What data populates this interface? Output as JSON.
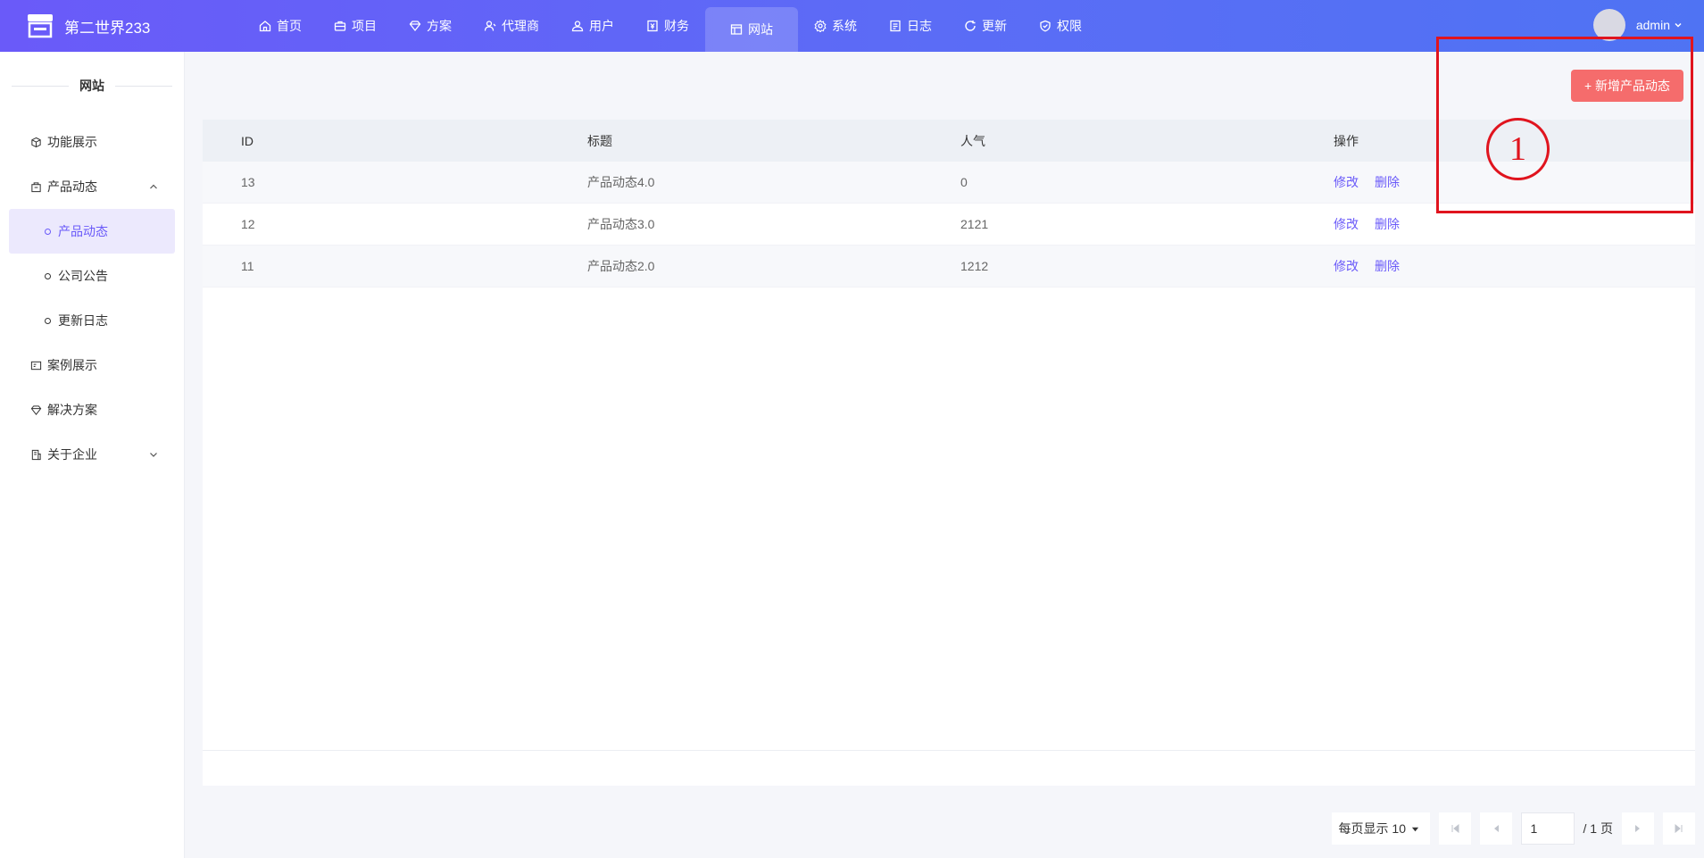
{
  "app": {
    "name": "第二世界233"
  },
  "nav": {
    "items": [
      {
        "label": "首页",
        "icon": "home-icon"
      },
      {
        "label": "项目",
        "icon": "briefcase-icon"
      },
      {
        "label": "方案",
        "icon": "diamond-icon"
      },
      {
        "label": "代理商",
        "icon": "agent-icon"
      },
      {
        "label": "用户",
        "icon": "users-icon"
      },
      {
        "label": "财务",
        "icon": "finance-icon"
      },
      {
        "label": "网站",
        "icon": "website-icon",
        "active": true
      },
      {
        "label": "系统",
        "icon": "gear-icon"
      },
      {
        "label": "日志",
        "icon": "log-icon"
      },
      {
        "label": "更新",
        "icon": "refresh-icon"
      },
      {
        "label": "权限",
        "icon": "shield-icon"
      }
    ]
  },
  "user": {
    "name": "admin"
  },
  "sidebar": {
    "title": "网站",
    "items": [
      {
        "label": "功能展示",
        "icon": "cube-icon"
      },
      {
        "label": "产品动态",
        "icon": "bag-icon",
        "expanded": true,
        "children": [
          {
            "label": "产品动态",
            "active": true
          },
          {
            "label": "公司公告"
          },
          {
            "label": "更新日志"
          }
        ]
      },
      {
        "label": "案例展示",
        "icon": "case-icon"
      },
      {
        "label": "解决方案",
        "icon": "diamond-icon"
      },
      {
        "label": "关于企业",
        "icon": "building-icon",
        "collapsible": true
      }
    ]
  },
  "toolbar": {
    "add_label": "+ 新增产品动态"
  },
  "table": {
    "columns": [
      "ID",
      "标题",
      "人气",
      "操作"
    ],
    "rows": [
      {
        "id": "13",
        "title": "产品动态4.0",
        "popularity": "0"
      },
      {
        "id": "12",
        "title": "产品动态3.0",
        "popularity": "2121"
      },
      {
        "id": "11",
        "title": "产品动态2.0",
        "popularity": "1212"
      }
    ],
    "actions": {
      "edit": "修改",
      "delete": "删除"
    }
  },
  "pagination": {
    "page_size_label": "每页显示 10",
    "current_page": "1",
    "total_label": "/ 1 页"
  },
  "annotation": {
    "label": "1",
    "color": "#e0141e"
  },
  "colors": {
    "accent": "#6a5af9",
    "danger": "#f56c6c"
  }
}
